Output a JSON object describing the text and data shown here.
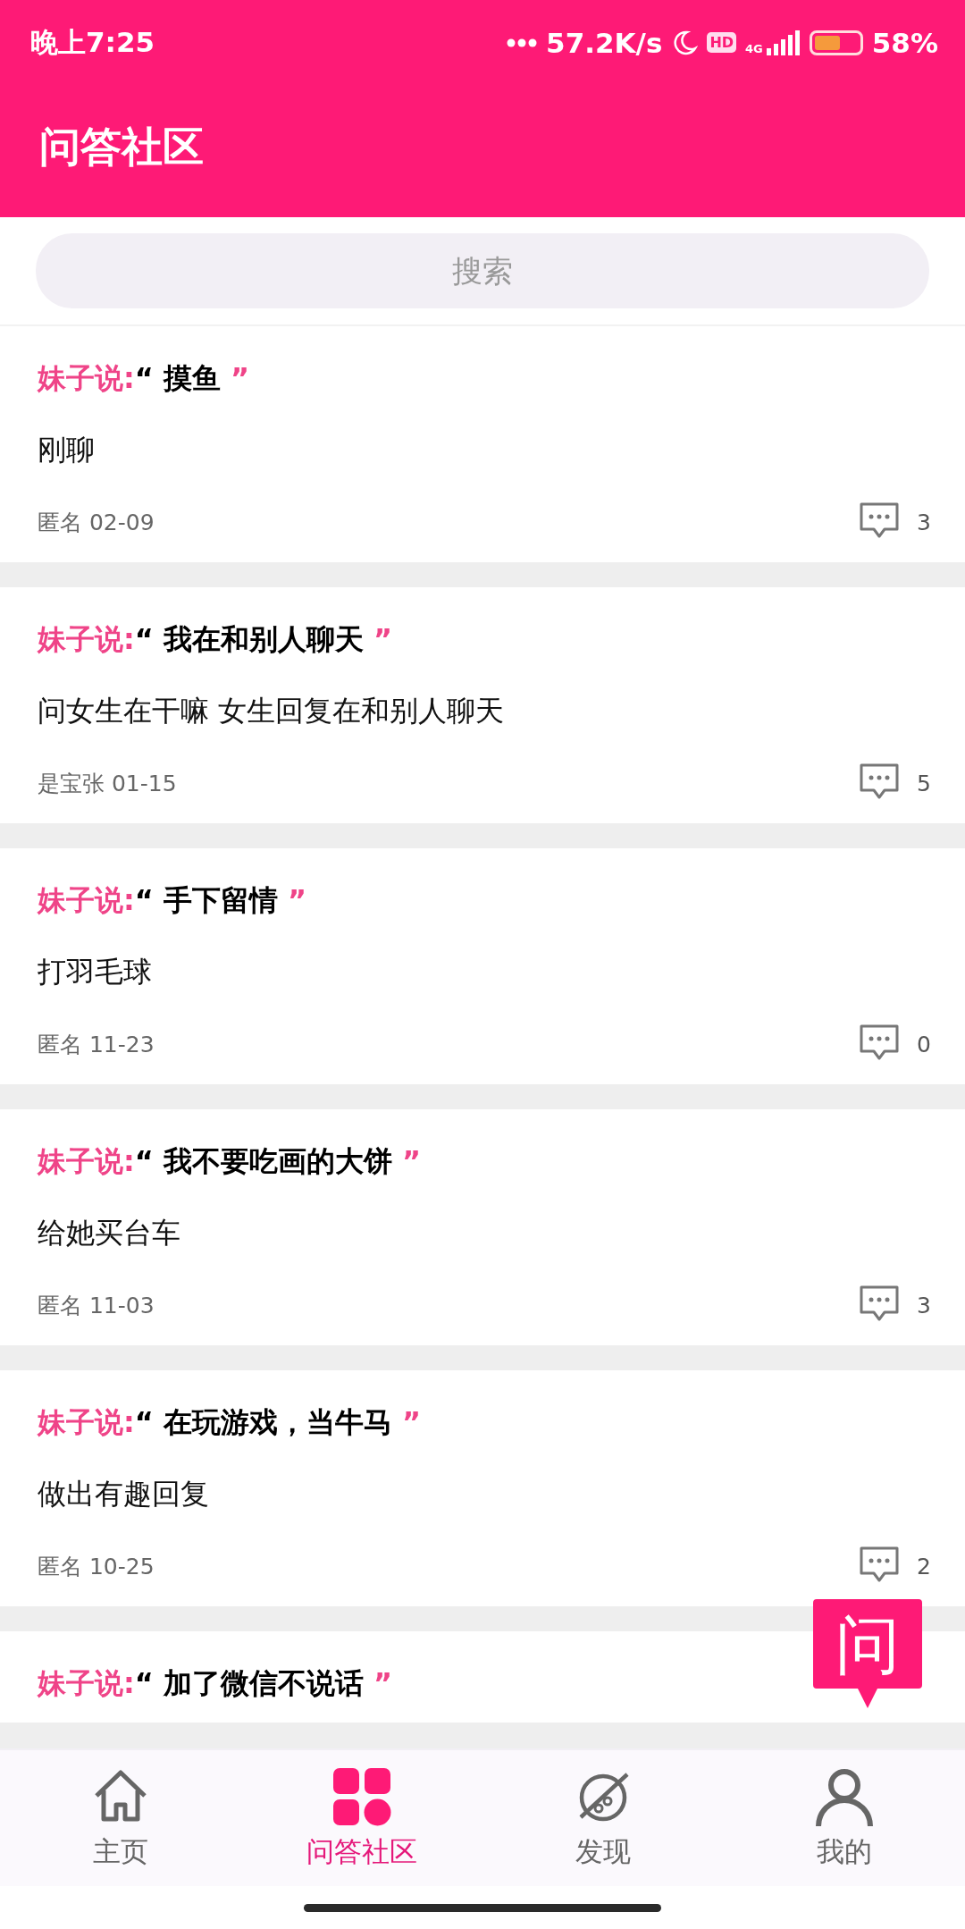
{
  "status_bar": {
    "time": "晚上7:25",
    "speed": "57.2K/s",
    "network": "4G",
    "hd": "HD",
    "battery": {
      "level": 0.58
    },
    "battery_percent": "58%"
  },
  "header": {
    "title": "问答社区"
  },
  "search": {
    "placeholder": "搜索"
  },
  "posts": [
    {
      "prefix": "妹子说:",
      "open_quote": "“",
      "topic": "摸鱼",
      "close_quote": "”",
      "body": "刚聊",
      "author": "匿名",
      "date": "02-09",
      "comments": "3"
    },
    {
      "prefix": "妹子说:",
      "open_quote": "“",
      "topic": "我在和别人聊天",
      "close_quote": "”",
      "body": "问女生在干嘛 女生回复在和别人聊天",
      "author": "是宝张",
      "date": "01-15",
      "comments": "5"
    },
    {
      "prefix": "妹子说:",
      "open_quote": "“",
      "topic": "手下留情",
      "close_quote": "”",
      "body": "打羽毛球",
      "author": "匿名",
      "date": "11-23",
      "comments": "0"
    },
    {
      "prefix": "妹子说:",
      "open_quote": "“",
      "topic": "我不要吃画的大饼",
      "close_quote": "”",
      "body": "给她买台车",
      "author": "匿名",
      "date": "11-03",
      "comments": "3"
    },
    {
      "prefix": "妹子说:",
      "open_quote": "“",
      "topic": "在玩游戏，当牛马",
      "close_quote": "”",
      "body": "做出有趣回复",
      "author": "匿名",
      "date": "10-25",
      "comments": "2"
    },
    {
      "prefix": "妹子说:",
      "open_quote": "“",
      "topic": "加了微信不说话",
      "close_quote": "”"
    }
  ],
  "ask_button": {
    "label": "问"
  },
  "tab_bar": [
    {
      "kind": "home",
      "label": "主页",
      "selected": false
    },
    {
      "kind": "community",
      "label": "问答社区",
      "selected": true
    },
    {
      "kind": "discover",
      "label": "发现",
      "selected": false
    },
    {
      "kind": "profile",
      "label": "我的",
      "selected": false
    }
  ]
}
